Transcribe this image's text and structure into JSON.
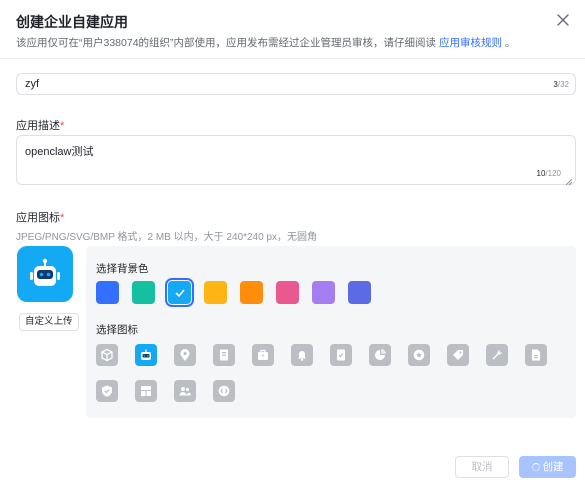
{
  "dialog": {
    "title": "创建企业自建应用",
    "desc_prefix": "该应用仅可在“用户338074的组织”内部使用，应用发布需经过企业管理员审核，请仔细阅读 ",
    "desc_link": "应用审核规则",
    "desc_suffix": " 。"
  },
  "name_field": {
    "value": "zyf",
    "count": "3",
    "max": "/32"
  },
  "description": {
    "label": "应用描述",
    "required_mark": "*",
    "value": "openclaw测试",
    "count": "10",
    "max": "/120"
  },
  "app_icon": {
    "label": "应用图标",
    "required_mark": "*",
    "hint": "JPEG/PNG/SVG/BMP 格式，2 MB 以内，大于 240*240 px，无圆角",
    "upload_label": "自定义上传",
    "bg_label": "选择背景色",
    "icon_label": "选择图标",
    "colors": [
      "#3370ff",
      "#14c0a0",
      "#14a9f5",
      "#ffb514",
      "#ff8c0a",
      "#e9598f",
      "#a47ef0",
      "#5c6ae6"
    ],
    "selected_color_index": 2,
    "icons": [
      "box-icon",
      "robot-icon",
      "location-pin-icon",
      "document-icon",
      "briefcase-icon",
      "bell-icon",
      "checklist-icon",
      "pie-chart-icon",
      "star-badge-icon",
      "tag-icon",
      "wrench-icon",
      "file-icon",
      "shield-check-icon",
      "layout-icon",
      "users-icon",
      "code-icon"
    ],
    "selected_icon_index": 1
  },
  "footer": {
    "cancel_label": "取消",
    "create_label": "创建"
  }
}
